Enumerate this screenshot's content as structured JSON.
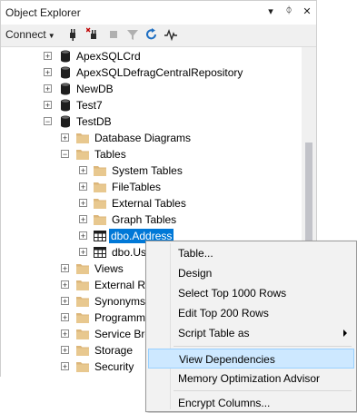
{
  "window": {
    "title": "Object Explorer"
  },
  "titlebar_icons": {
    "dropdown": "▾",
    "pin": "ᛰ",
    "close": "✕"
  },
  "toolbar": {
    "connect_label": "Connect",
    "icons": [
      "connect-icon",
      "disconnect-icon",
      "stop-icon",
      "filter-icon",
      "refresh-icon",
      "activity-monitor-icon"
    ]
  },
  "tree": {
    "items": [
      {
        "label": "ApexSQLCrd",
        "icon": "database-icon",
        "expander": "+"
      },
      {
        "label": "ApexSQLDefragCentralRepository",
        "icon": "database-icon",
        "expander": "+"
      },
      {
        "label": "NewDB",
        "icon": "database-icon",
        "expander": "+"
      },
      {
        "label": "Test7",
        "icon": "database-icon",
        "expander": "+"
      },
      {
        "label": "TestDB",
        "icon": "database-icon",
        "expander": "−"
      },
      {
        "label": "Database Diagrams",
        "icon": "folder-icon",
        "expander": "+"
      },
      {
        "label": "Tables",
        "icon": "folder-icon",
        "expander": "−"
      },
      {
        "label": "System Tables",
        "icon": "folder-icon",
        "expander": "+"
      },
      {
        "label": "FileTables",
        "icon": "folder-icon",
        "expander": "+"
      },
      {
        "label": "External Tables",
        "icon": "folder-icon",
        "expander": "+"
      },
      {
        "label": "Graph Tables",
        "icon": "folder-icon",
        "expander": "+"
      },
      {
        "label": "dbo.Address",
        "icon": "table-icon",
        "expander": "+"
      },
      {
        "label": "dbo.Us",
        "icon": "table-icon",
        "expander": "+"
      },
      {
        "label": "Views",
        "icon": "folder-icon",
        "expander": "+"
      },
      {
        "label": "External Re",
        "icon": "folder-icon",
        "expander": "+"
      },
      {
        "label": "Synonyms",
        "icon": "folder-icon",
        "expander": "+"
      },
      {
        "label": "Programm",
        "icon": "folder-icon",
        "expander": "+"
      },
      {
        "label": "Service Bro",
        "icon": "folder-icon",
        "expander": "+"
      },
      {
        "label": "Storage",
        "icon": "folder-icon",
        "expander": "+"
      },
      {
        "label": "Security",
        "icon": "folder-icon",
        "expander": "+"
      }
    ]
  },
  "context_menu": {
    "items": [
      {
        "label": "Table..."
      },
      {
        "label": "Design"
      },
      {
        "label": "Select Top 1000 Rows"
      },
      {
        "label": "Edit Top 200 Rows"
      },
      {
        "label": "Script Table as"
      },
      {
        "label": "View Dependencies"
      },
      {
        "label": "Memory Optimization Advisor"
      },
      {
        "label": "Encrypt Columns..."
      }
    ]
  },
  "colors": {
    "selection": "#0078d7",
    "menu_highlight": "#cde8ff",
    "folder": "#dcb67a"
  }
}
